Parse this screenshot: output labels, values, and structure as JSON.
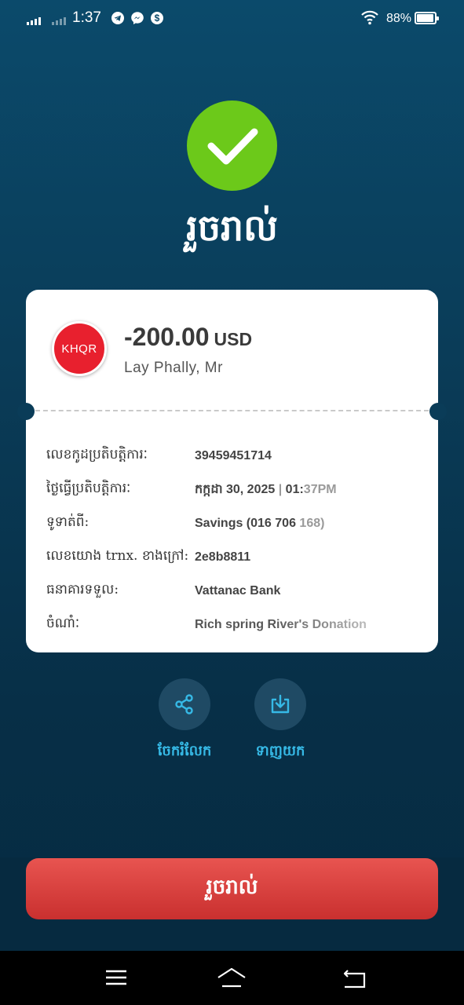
{
  "status_bar": {
    "time": "1:37",
    "battery": "88%",
    "icons": [
      "signal-icon",
      "telegram-icon",
      "messenger-icon",
      "dollar-icon",
      "wifi-icon",
      "battery-icon"
    ]
  },
  "success": {
    "icon": "checkmark-icon",
    "title": "រួចរាល់"
  },
  "transaction": {
    "logo_text": "KHQR",
    "amount": "-200.00",
    "currency": "USD",
    "recipient": "Lay Phally, Mr",
    "details": [
      {
        "label": "លេខកូដប្រតិបត្តិការៈ",
        "value": "39459451714"
      },
      {
        "label": "ថ្ងៃធ្វើប្រតិបត្តិការៈ",
        "value_date": "កក្កដា 30, 2025",
        "separator": "|",
        "value_time_bold": "01:",
        "value_time_light": "37PM"
      },
      {
        "label": "ទូទាត់ពី:",
        "value_bold": "Savings (016 706",
        "value_light": "168)"
      },
      {
        "label": "លេខយោង trnx. ខាងក្រៅ:",
        "value": "2e8b8811"
      },
      {
        "label": "ធនាគារទទួល:",
        "value": "Vattanac Bank"
      },
      {
        "label": "ចំណាំៈ",
        "value": "Rich spring River's Donation"
      }
    ]
  },
  "actions": {
    "share_label": "ចែករំលែក",
    "download_label": "ទាញយក"
  },
  "done_button": "រួចរាល់",
  "colors": {
    "success_green": "#6cc91a",
    "accent_blue": "#36b9e6",
    "button_red": "#d63c3a"
  }
}
